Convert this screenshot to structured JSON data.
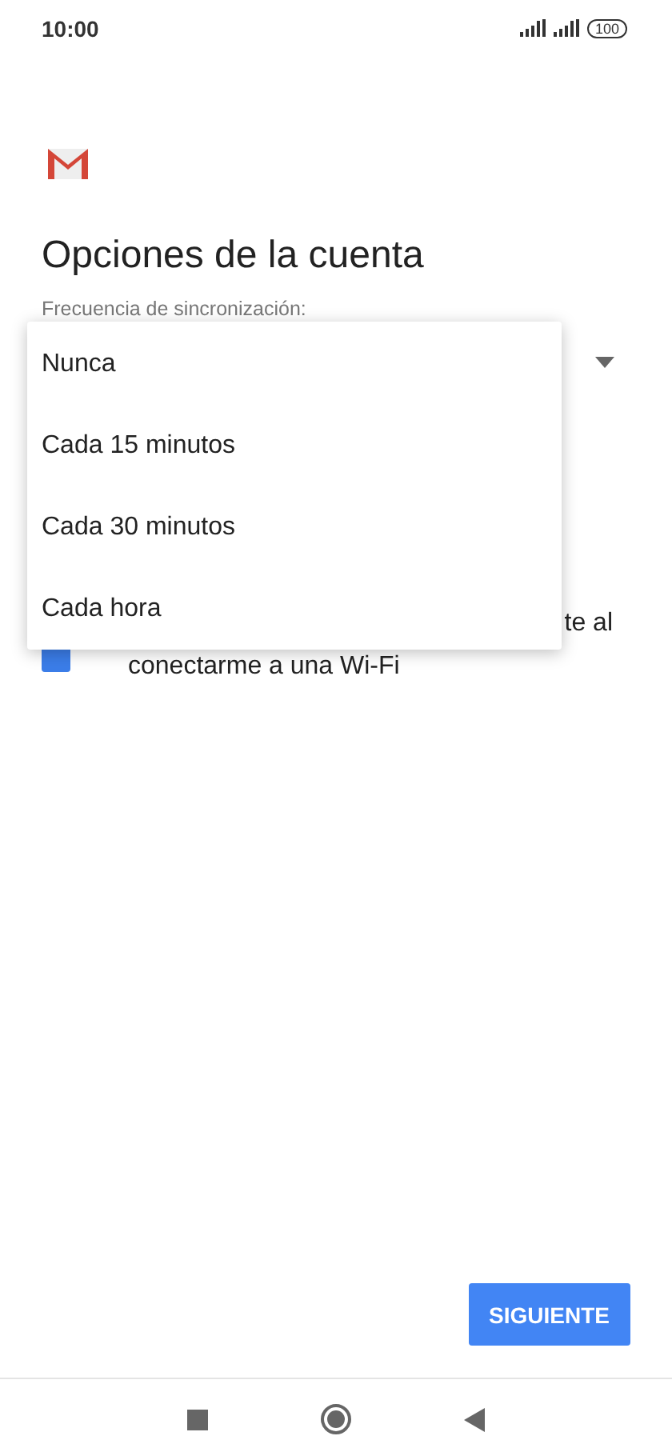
{
  "status_bar": {
    "time": "10:00",
    "battery": "100"
  },
  "title": "Opciones de la cuenta",
  "sync_frequency": {
    "label": "Frecuencia de sincronización:"
  },
  "wifi_option": {
    "text_fragment": "te al",
    "text_line_2": "conectarme a una Wi-Fi",
    "checked": true
  },
  "dropdown_menu": {
    "items": [
      {
        "label": "Nunca"
      },
      {
        "label": "Cada 15 minutos"
      },
      {
        "label": "Cada 30 minutos"
      },
      {
        "label": "Cada hora"
      }
    ]
  },
  "next_button": "SIGUIENTE"
}
